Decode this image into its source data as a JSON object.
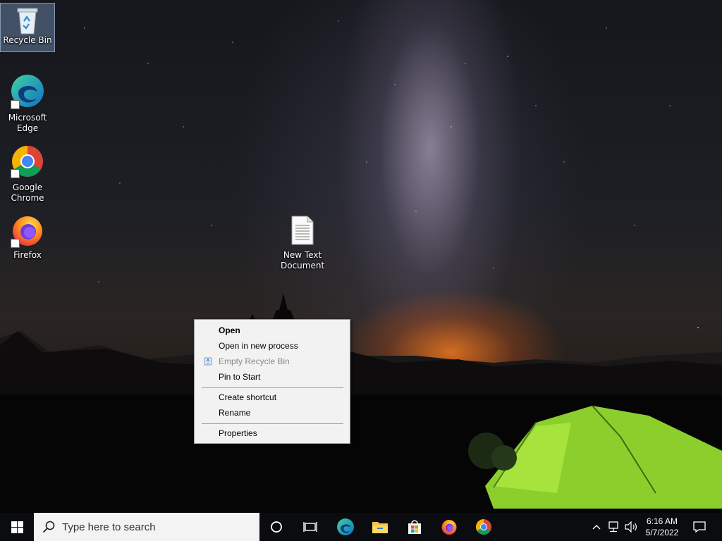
{
  "desktop": {
    "icons": [
      {
        "label": "Recycle Bin",
        "icon": "recycle-bin-icon"
      },
      {
        "label": "Microsoft Edge",
        "icon": "edge-icon"
      },
      {
        "label": "Google Chrome",
        "icon": "chrome-icon"
      },
      {
        "label": "Firefox",
        "icon": "firefox-icon"
      },
      {
        "label": "New Text Document",
        "icon": "text-document-icon"
      }
    ]
  },
  "context_menu": {
    "items": [
      {
        "label": "Open",
        "bold": true
      },
      {
        "label": "Open in new process"
      },
      {
        "label": "Empty Recycle Bin",
        "disabled": true,
        "icon": "recycle-small-icon"
      },
      {
        "label": "Pin to Start"
      },
      {
        "label": "Create shortcut"
      },
      {
        "label": "Rename"
      },
      {
        "label": "Properties"
      }
    ]
  },
  "taskbar": {
    "search_placeholder": "Type here to search",
    "pinned": [
      "cortana-icon",
      "task-view-icon",
      "edge-icon",
      "file-explorer-icon",
      "store-icon",
      "firefox-icon",
      "chrome-icon"
    ],
    "clock": {
      "time": "6:16 AM",
      "date": "5/7/2022"
    }
  },
  "colors": {
    "taskbar_bg": "#0a0c0f",
    "menu_bg": "#f2f2f2",
    "selection": "#7896be"
  }
}
